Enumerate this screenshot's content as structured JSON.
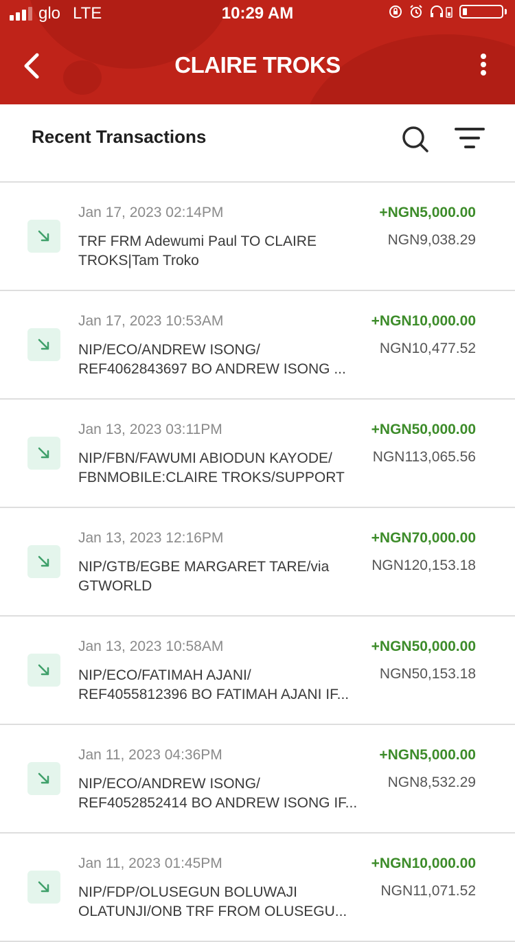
{
  "status_bar": {
    "carrier": "glo",
    "network": "LTE",
    "time": "10:29 AM"
  },
  "header": {
    "title": "CLAIRE TROKS"
  },
  "section": {
    "title": "Recent Transactions"
  },
  "colors": {
    "brand_red": "#bf2319",
    "credit_green": "#3d8c2a",
    "icon_bg": "#e4f5ec"
  },
  "transactions": [
    {
      "date": "Jan 17, 2023 02:14PM",
      "description": "TRF FRM Adewumi   Paul TO CLAIRE TROKS|Tam Troko",
      "amount": "+NGN5,000.00",
      "balance": "NGN9,038.29"
    },
    {
      "date": "Jan 17, 2023 10:53AM",
      "description": "NIP/ECO/ANDREW ISONG/ REF4062843697 BO ANDREW ISONG ...",
      "amount": "+NGN10,000.00",
      "balance": "NGN10,477.52"
    },
    {
      "date": "Jan 13, 2023 03:11PM",
      "description": "NIP/FBN/FAWUMI ABIODUN KAYODE/ FBNMOBILE:CLAIRE TROKS/SUPPORT",
      "amount": "+NGN50,000.00",
      "balance": "NGN113,065.56"
    },
    {
      "date": "Jan 13, 2023 12:16PM",
      "description": "NIP/GTB/EGBE MARGARET TARE/via GTWORLD",
      "amount": "+NGN70,000.00",
      "balance": "NGN120,153.18"
    },
    {
      "date": "Jan 13, 2023 10:58AM",
      "description": "NIP/ECO/FATIMAH AJANI/ REF4055812396 BO FATIMAH AJANI IF...",
      "amount": "+NGN50,000.00",
      "balance": "NGN50,153.18"
    },
    {
      "date": "Jan 11, 2023 04:36PM",
      "description": "NIP/ECO/ANDREW ISONG/ REF4052852414 BO ANDREW ISONG IF...",
      "amount": "+NGN5,000.00",
      "balance": "NGN8,532.29"
    },
    {
      "date": "Jan 11, 2023 01:45PM",
      "description": "NIP/FDP/OLUSEGUN BOLUWAJI OLATUNJI/ONB TRF FROM OLUSEGU...",
      "amount": "+NGN10,000.00",
      "balance": "NGN11,071.52"
    }
  ]
}
